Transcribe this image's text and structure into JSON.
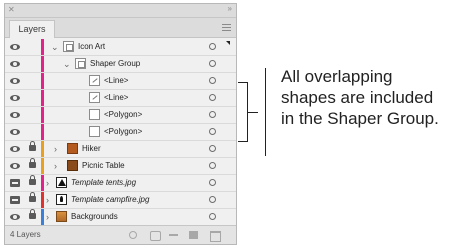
{
  "panel": {
    "tab_label": "Layers",
    "footer_count": "4 Layers"
  },
  "layers": [
    {
      "name": "Icon Art",
      "italic": false,
      "icon": "folder-thumb",
      "color": "#e2228a",
      "locked": false,
      "template": false,
      "expanded": true,
      "indent": 0
    },
    {
      "name": "Shaper Group",
      "italic": false,
      "icon": "folder-thumb",
      "color": "#e2228a",
      "locked": false,
      "template": false,
      "expanded": true,
      "indent": 1
    },
    {
      "name": "<Line>",
      "italic": false,
      "icon": "line-thumb",
      "color": "#e2228a",
      "locked": false,
      "template": false,
      "indent": 2
    },
    {
      "name": "<Line>",
      "italic": false,
      "icon": "line-thumb",
      "color": "#e2228a",
      "locked": false,
      "template": false,
      "indent": 2
    },
    {
      "name": "<Polygon>",
      "italic": false,
      "icon": "polygon-thumb",
      "color": "#e2228a",
      "locked": false,
      "template": false,
      "indent": 2
    },
    {
      "name": "<Polygon>",
      "italic": false,
      "icon": "polygon-thumb",
      "color": "#e2228a",
      "locked": false,
      "template": false,
      "indent": 2
    },
    {
      "name": "Hiker",
      "italic": false,
      "icon": "hiker-thumb",
      "color": "#e8a020",
      "locked": true,
      "template": false,
      "expanded": false,
      "indent": 0
    },
    {
      "name": "Picnic Table",
      "italic": false,
      "icon": "picnic-thumb",
      "color": "#e8a020",
      "locked": true,
      "template": false,
      "expanded": false,
      "indent": 0
    },
    {
      "name": "Template tents.jpg",
      "italic": true,
      "icon": "tent-thumb",
      "color": "#e2228a",
      "locked": true,
      "template": true,
      "expanded": false,
      "indent": 0
    },
    {
      "name": "Template campfire.jpg",
      "italic": true,
      "icon": "campfire-thumb",
      "color": "#e03030",
      "locked": true,
      "template": true,
      "expanded": false,
      "indent": 0
    },
    {
      "name": "Backgrounds",
      "italic": false,
      "icon": "background-thumb",
      "color": "#3a7fd8",
      "locked": true,
      "template": false,
      "expanded": false,
      "indent": 0
    }
  ],
  "annotation": {
    "line1": "All overlapping",
    "line2": "shapes are included",
    "line3": "in the Shaper Group."
  }
}
